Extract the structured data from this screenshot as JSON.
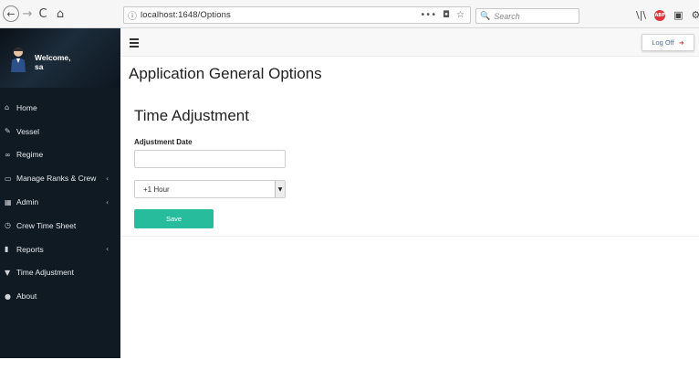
{
  "browser": {
    "back_glyph": "←",
    "forward_glyph": "→",
    "reload_glyph": "C",
    "home_glyph": "⌂",
    "info_glyph": "ⓘ",
    "url": "localhost:1648/Options",
    "url_icons": [
      "•••",
      "◘",
      "☆"
    ],
    "search_glyph": "🔍",
    "search_placeholder": "Search",
    "toolbar_icons": [
      "\\|\\",
      "ABP",
      "▣",
      "⚙"
    ]
  },
  "sidebar": {
    "welcome_line1": "Welcome,",
    "welcome_line2": "sa",
    "items": [
      {
        "icon": "home-icon",
        "glyph": "⌂",
        "label": "Home",
        "caret": ""
      },
      {
        "icon": "edit-icon",
        "glyph": "✎",
        "label": "Vessel",
        "caret": ""
      },
      {
        "icon": "link-icon",
        "glyph": "∞",
        "label": "Regime",
        "caret": ""
      },
      {
        "icon": "monitor-icon",
        "glyph": "▭",
        "label": "Manage Ranks & Crew",
        "caret": "‹"
      },
      {
        "icon": "table-icon",
        "glyph": "▦",
        "label": "Admin",
        "caret": "‹"
      },
      {
        "icon": "clock-icon",
        "glyph": "◷",
        "label": "Crew Time Sheet",
        "caret": ""
      },
      {
        "icon": "chart-icon",
        "glyph": "▮",
        "label": "Reports",
        "caret": "‹"
      },
      {
        "icon": "filter-icon",
        "glyph": "▼",
        "label": "Time Adjustment",
        "caret": ""
      },
      {
        "icon": "user-icon",
        "glyph": "●",
        "label": "About",
        "caret": ""
      }
    ]
  },
  "topbar": {
    "logoff_label": "Log Off",
    "logoff_glyph": "➜"
  },
  "main": {
    "page_title": "Application General Options",
    "section_title": "Time Adjustment",
    "adjustment_date_label": "Adjustment Date",
    "adjustment_date_value": "",
    "hour_selected": "+1 Hour",
    "select_arrow_glyph": "▼",
    "save_label": "Save"
  },
  "colors": {
    "sidebar_bg": "#0f1a23",
    "save_button": "#26bc9c",
    "logoff_text": "#4a6c9a"
  }
}
